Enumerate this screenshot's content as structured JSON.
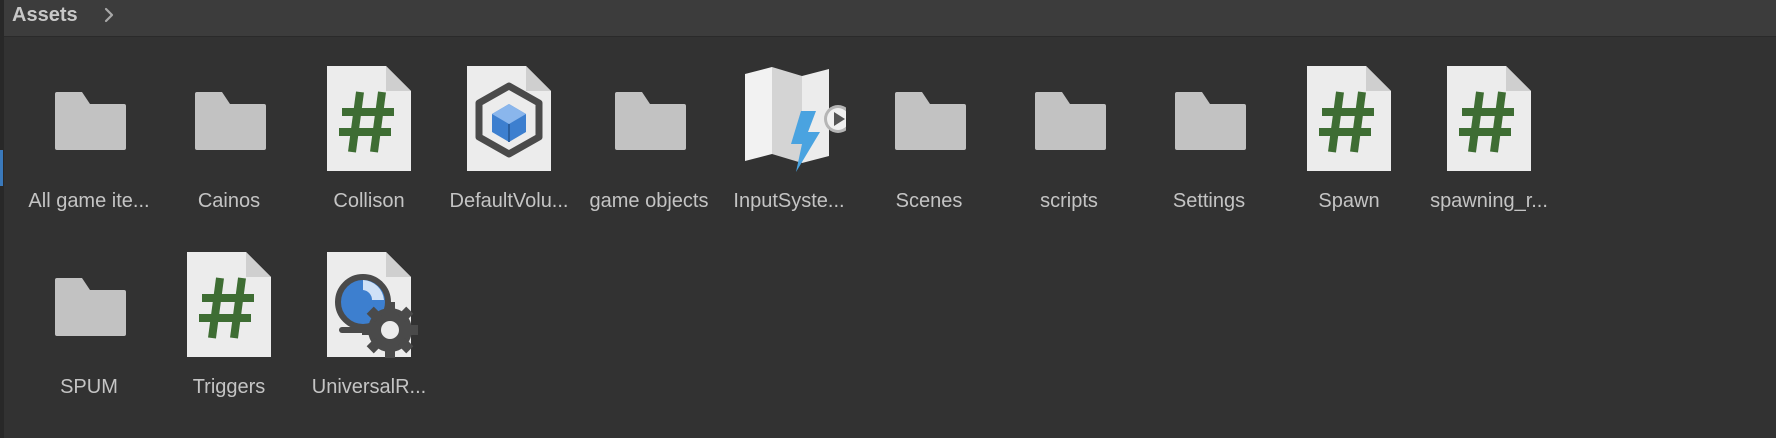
{
  "breadcrumb": {
    "label": "Assets"
  },
  "assets": [
    {
      "label": "All game ite...",
      "type": "folder"
    },
    {
      "label": "Cainos",
      "type": "folder"
    },
    {
      "label": "Collison",
      "type": "script"
    },
    {
      "label": "DefaultVolu...",
      "type": "volume-profile"
    },
    {
      "label": "game objects",
      "type": "folder"
    },
    {
      "label": "InputSyste...",
      "type": "input-actions"
    },
    {
      "label": "Scenes",
      "type": "folder"
    },
    {
      "label": "scripts",
      "type": "folder"
    },
    {
      "label": "Settings",
      "type": "folder"
    },
    {
      "label": "Spawn",
      "type": "script"
    },
    {
      "label": "spawning_r...",
      "type": "script"
    },
    {
      "label": "SPUM",
      "type": "folder"
    },
    {
      "label": "Triggers",
      "type": "script"
    },
    {
      "label": "UniversalR...",
      "type": "render-pipeline-asset"
    }
  ],
  "colors": {
    "background": "#323232",
    "breadcrumb_bar": "#3c3c3c",
    "folder_icon": "#c2c2c2",
    "script_hash": "#3e6d33",
    "accent_blue": "#3a79bb"
  }
}
